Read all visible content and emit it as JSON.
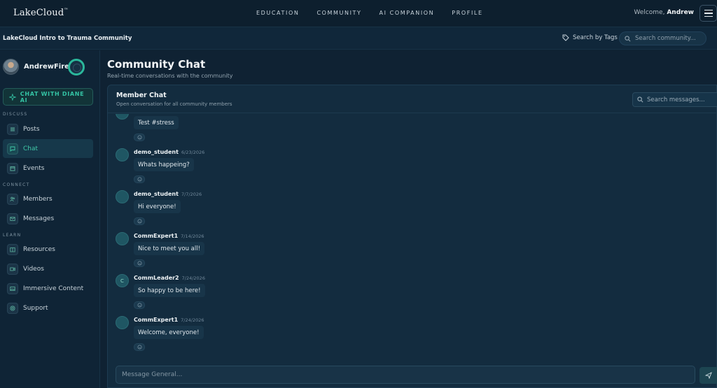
{
  "brand": {
    "logo": "LakeCloud",
    "trademark": "™"
  },
  "nav": {
    "links": [
      "EDUCATION",
      "COMMUNITY",
      "AI COMPANION",
      "PROFILE"
    ]
  },
  "header": {
    "welcome_prefix": "Welcome,",
    "user": "Andrew"
  },
  "subheader": {
    "community_title": "LakeCloud Intro to Trauma Community",
    "tags_label": "Search by Tags",
    "search_placeholder": "Search community..."
  },
  "sidebar": {
    "username": "AndrewFirek",
    "ai_button": "CHAT WITH DIANE AI",
    "sections": {
      "discuss": "DISCUSS",
      "connect": "CONNECT",
      "learn": "LEARN"
    },
    "items": [
      {
        "label": "Posts",
        "icon": "posts-icon"
      },
      {
        "label": "Chat",
        "icon": "chat-icon",
        "active": true
      },
      {
        "label": "Events",
        "icon": "calendar-icon"
      },
      {
        "label": "Members",
        "icon": "members-icon"
      },
      {
        "label": "Messages",
        "icon": "mail-icon"
      },
      {
        "label": "Resources",
        "icon": "book-icon"
      },
      {
        "label": "Videos",
        "icon": "video-icon"
      },
      {
        "label": "Immersive Content",
        "icon": "image-icon"
      },
      {
        "label": "Support",
        "icon": "support-icon"
      }
    ]
  },
  "main": {
    "title": "Community Chat",
    "subtitle": "Real-time conversations with the community",
    "panel_title": "Member Chat",
    "panel_subtitle": "Open conversation for all community members",
    "search_placeholder": "Search messages...",
    "composer_placeholder": "Message General..."
  },
  "messages": [
    {
      "author": "",
      "date": "",
      "text": "Test #stress",
      "avatar": ""
    },
    {
      "author": "demo_student",
      "date": "6/23/2026",
      "text": "Whats happeing?",
      "avatar": ""
    },
    {
      "author": "demo_student",
      "date": "7/7/2026",
      "text": "Hi everyone!",
      "avatar": ""
    },
    {
      "author": "CommExpert1",
      "date": "7/14/2026",
      "text": "Nice to meet you all!",
      "avatar": ""
    },
    {
      "author": "CommLeader2",
      "date": "7/24/2026",
      "text": "So happy to be here!",
      "avatar": "C"
    },
    {
      "author": "CommExpert1",
      "date": "7/24/2026",
      "text": "Welcome, everyone!",
      "avatar": ""
    }
  ],
  "colors": {
    "background": "#0f2233",
    "accent": "#34c3a4",
    "panel": "#132c3f"
  }
}
